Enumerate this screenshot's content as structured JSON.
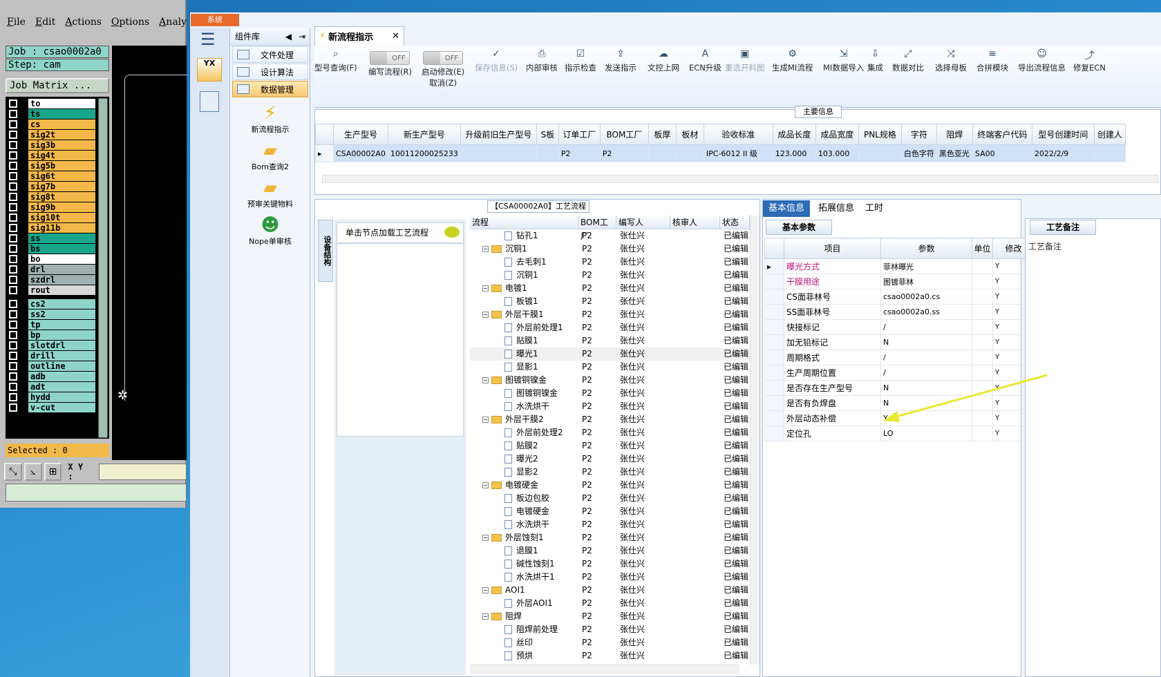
{
  "genesis": {
    "menu": [
      "File",
      "Edit",
      "Actions",
      "Options",
      "Analy"
    ],
    "job": "Job : csao0002a0",
    "step": "Step: cam",
    "matrix": "Job Matrix ...",
    "layers": [
      {
        "name": "to",
        "color": "#ffffff"
      },
      {
        "name": "ts",
        "color": "#19a68c"
      },
      {
        "name": "cs",
        "color": "#f2b84a"
      },
      {
        "name": "sig2t",
        "color": "#f2b84a"
      },
      {
        "name": "sig3b",
        "color": "#f2b84a"
      },
      {
        "name": "sig4t",
        "color": "#f2b84a"
      },
      {
        "name": "sig5b",
        "color": "#f2b84a"
      },
      {
        "name": "sig6t",
        "color": "#f2b84a"
      },
      {
        "name": "sig7b",
        "color": "#f2b84a"
      },
      {
        "name": "sig8t",
        "color": "#f2b84a"
      },
      {
        "name": "sig9b",
        "color": "#f2b84a"
      },
      {
        "name": "sig10t",
        "color": "#f2b84a"
      },
      {
        "name": "sig11b",
        "color": "#f2b84a"
      },
      {
        "name": "ss",
        "color": "#19a68c"
      },
      {
        "name": "bs",
        "color": "#19a68c"
      },
      {
        "name": "bo",
        "color": "#ffffff"
      },
      {
        "name": "drl",
        "color": "#9fb0b0"
      },
      {
        "name": "szdrl",
        "color": "#9fb0b0"
      },
      {
        "name": "rout",
        "color": "#d8d8d8"
      },
      {
        "name": "cs2",
        "color": "#8fd4c8"
      },
      {
        "name": "ss2",
        "color": "#8fd4c8"
      },
      {
        "name": "tp",
        "color": "#8fd4c8"
      },
      {
        "name": "bp",
        "color": "#8fd4c8"
      },
      {
        "name": "slotdrl",
        "color": "#8fd4c8"
      },
      {
        "name": "drill",
        "color": "#8fd4c8"
      },
      {
        "name": "outline",
        "color": "#8fd4c8"
      },
      {
        "name": "adb",
        "color": "#8fd4c8"
      },
      {
        "name": "adt",
        "color": "#8fd4c8"
      },
      {
        "name": "hydd",
        "color": "#8fd4c8"
      },
      {
        "name": "v-cut",
        "color": "#8fd4c8"
      }
    ],
    "selected": "Selected : 0",
    "xy_label": "X Y :"
  },
  "app": {
    "system_tab": "系统",
    "sidebar": {
      "title": "组件库",
      "items": [
        "文件处理",
        "设计算法",
        "数据管理"
      ],
      "tools": [
        "新流程指示",
        "Bom查询2",
        "预审关键物料",
        "Nope单审核"
      ]
    },
    "doc_tab": "新流程指示",
    "ribbon": [
      {
        "label": "型号查询(F)",
        "icon": "search-icon"
      },
      {
        "label": "编写流程(R)",
        "toggle": "OFF"
      },
      {
        "label": "启动修改(E)",
        "sub": "取消(Z)",
        "toggle": "OFF"
      },
      {
        "label": "保存信息(S)",
        "disabled": true
      },
      {
        "label": "内部审核"
      },
      {
        "label": "指示检查"
      },
      {
        "label": "发送指示"
      },
      {
        "label": "文控上网"
      },
      {
        "label": "ECN升级"
      },
      {
        "label": "重选开料图",
        "disabled": true
      },
      {
        "label": "生成MI流程"
      },
      {
        "label": "MI数据导入"
      },
      {
        "label": "集成"
      },
      {
        "label": "数据对比"
      },
      {
        "label": "选择母板"
      },
      {
        "label": "合拼模块"
      },
      {
        "label": "导出流程信息"
      },
      {
        "label": "修复ECN"
      }
    ],
    "main_info": {
      "title": "主要信息",
      "columns": [
        "生产型号",
        "新生产型号",
        "升级前旧生产型号",
        "S板",
        "订单工厂",
        "BOM工厂",
        "板厚",
        "板材",
        "验收标准",
        "成品长度",
        "成品宽度",
        "PNL规格",
        "字符",
        "阻焊",
        "终端客户代码",
        "型号创建时间",
        "创建人"
      ],
      "row": [
        "CSA00002A0",
        "10011200025233",
        "",
        "",
        "P2",
        "P2",
        "",
        "",
        "IPC-6012 II 级",
        "123.000",
        "103.000",
        "",
        "白色字符",
        "黑色亚光",
        "SA00",
        "2022/2/9",
        ""
      ]
    },
    "process": {
      "title": "【CSA00002A0】工艺流程",
      "side_tab": "设备结构",
      "hint": "单击节点加载工艺流程",
      "columns": [
        "流程",
        "BOM工厂",
        "编写人",
        "核审人",
        "状态"
      ],
      "rows": [
        {
          "name": "钻孔1",
          "level": 1,
          "type": "doc"
        },
        {
          "name": "沉铜1",
          "level": 0,
          "type": "folder"
        },
        {
          "name": "去毛刺1",
          "level": 1,
          "type": "doc"
        },
        {
          "name": "沉铜1",
          "level": 1,
          "type": "doc"
        },
        {
          "name": "电镀1",
          "level": 0,
          "type": "folder"
        },
        {
          "name": "板镀1",
          "level": 1,
          "type": "doc"
        },
        {
          "name": "外层干膜1",
          "level": 0,
          "type": "folder"
        },
        {
          "name": "外层前处理1",
          "level": 1,
          "type": "doc"
        },
        {
          "name": "贴膜1",
          "level": 1,
          "type": "doc"
        },
        {
          "name": "曝光1",
          "level": 1,
          "type": "doc",
          "selected": true
        },
        {
          "name": "显影1",
          "level": 1,
          "type": "doc"
        },
        {
          "name": "图镀铜镍金",
          "level": 0,
          "type": "folder"
        },
        {
          "name": "图镀铜镍金",
          "level": 1,
          "type": "doc"
        },
        {
          "name": "水洗烘干",
          "level": 1,
          "type": "doc"
        },
        {
          "name": "外层干膜2",
          "level": 0,
          "type": "folder"
        },
        {
          "name": "外层前处理2",
          "level": 1,
          "type": "doc"
        },
        {
          "name": "贴膜2",
          "level": 1,
          "type": "doc"
        },
        {
          "name": "曝光2",
          "level": 1,
          "type": "doc"
        },
        {
          "name": "显影2",
          "level": 1,
          "type": "doc"
        },
        {
          "name": "电镀硬金",
          "level": 0,
          "type": "folder"
        },
        {
          "name": "板边包胶",
          "level": 1,
          "type": "doc"
        },
        {
          "name": "电镀硬金",
          "level": 1,
          "type": "doc"
        },
        {
          "name": "水洗烘干",
          "level": 1,
          "type": "doc"
        },
        {
          "name": "外层蚀刻1",
          "level": 0,
          "type": "folder"
        },
        {
          "name": "退膜1",
          "level": 1,
          "type": "doc"
        },
        {
          "name": "碱性蚀刻1",
          "level": 1,
          "type": "doc"
        },
        {
          "name": "水洗烘干1",
          "level": 1,
          "type": "doc"
        },
        {
          "name": "AOI1",
          "level": 0,
          "type": "folder"
        },
        {
          "name": "外层AOI1",
          "level": 1,
          "type": "doc"
        },
        {
          "name": "阻焊",
          "level": 0,
          "type": "folder"
        },
        {
          "name": "阻焊前处理",
          "level": 1,
          "type": "doc"
        },
        {
          "name": "丝印",
          "level": 1,
          "type": "doc"
        },
        {
          "name": "预烘",
          "level": 1,
          "type": "doc"
        }
      ],
      "bom": "P2",
      "writer": "张仕兴",
      "status": "已编辑"
    },
    "params": {
      "tabs": [
        "基本信息",
        "拓展信息",
        "工时"
      ],
      "sub_tab": "基本参数",
      "columns": [
        "项目",
        "参数",
        "单位",
        "修改"
      ],
      "rows": [
        {
          "k": "曝光方式",
          "v": "菲林曝光",
          "m": "Y",
          "pink": true
        },
        {
          "k": "干膜用途",
          "v": "图镀菲林",
          "m": "Y",
          "pink": true
        },
        {
          "k": "CS面菲林号",
          "v": "csao0002a0.cs",
          "m": "Y"
        },
        {
          "k": "SS面菲林号",
          "v": "csao0002a0.ss",
          "m": "Y"
        },
        {
          "k": "快接标记",
          "v": "/",
          "m": "Y"
        },
        {
          "k": "加无铅标记",
          "v": "N",
          "m": "Y"
        },
        {
          "k": "周期格式",
          "v": "/",
          "m": "Y"
        },
        {
          "k": "生产周期位置",
          "v": "/",
          "m": "Y"
        },
        {
          "k": "是否存在生产型号",
          "v": "N",
          "m": "Y"
        },
        {
          "k": "是否有负焊盘",
          "v": "N",
          "m": "Y"
        },
        {
          "k": "外层动态补偿",
          "v": "Y",
          "m": "Y"
        },
        {
          "k": "定位孔",
          "v": "LO",
          "m": "Y"
        }
      ]
    },
    "remark": {
      "tab": "工艺备注",
      "label": "工艺备注"
    }
  }
}
